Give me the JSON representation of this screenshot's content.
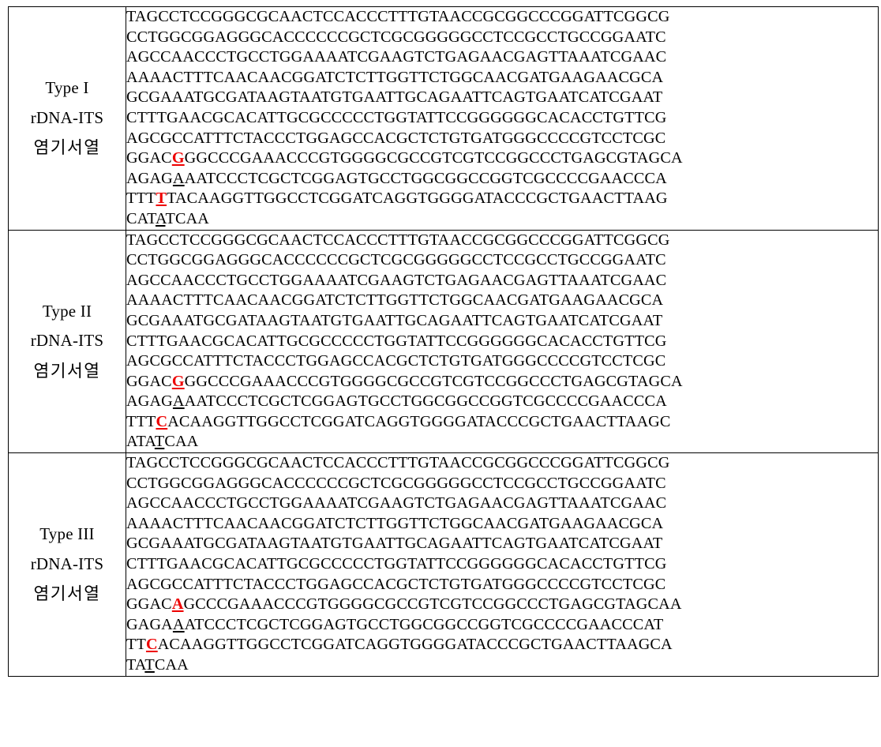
{
  "table": {
    "colors": {
      "mutation": "#ee0000",
      "text": "#000000",
      "border": "#000000",
      "background": "#ffffff"
    },
    "rows": [
      {
        "label": {
          "type_line": "Type I",
          "gene_line": "rDNA-ITS",
          "korean_line": "염기서열"
        },
        "sequence_lines": [
          [
            {
              "t": "TAGCCTCCGGGCGCAACTCCACCCTTTGTAACCGCGGCCCGGATTCGGCG",
              "s": "plain"
            }
          ],
          [
            {
              "t": "CCTGGCGGAGGGCACCCCCCGCTCGCGGGGGCCTCCGCCTGCCGGAATC",
              "s": "plain"
            }
          ],
          [
            {
              "t": "AGCCAACCCTGCCTGGAAAATCGAAGTCTGAGAACGAGTTAAATCGAAC",
              "s": "plain"
            }
          ],
          [
            {
              "t": "AAAACTTTCAACAACGGATCTCTTGGTTCTGGCAACGATGAAGAACGCA",
              "s": "plain"
            }
          ],
          [
            {
              "t": "GCGAAATGCGATAAGTAATGTGAATTGCAGAATTCAGTGAATCATCGAAT",
              "s": "plain"
            }
          ],
          [
            {
              "t": "CTTTGAACGCACATTGCGCCCCCTGGTATTCCGGGGGGCACACCTGTTCG",
              "s": "plain"
            }
          ],
          [
            {
              "t": "AGCGCCATTTCTACCCTGGAGCCACGCTCTGTGATGGGCCCCGTCCTCGC",
              "s": "plain"
            }
          ],
          [
            {
              "t": "GGAC",
              "s": "plain"
            },
            {
              "t": "G",
              "s": "mut"
            },
            {
              "t": "GGCCCGAAACCCGTGGGGCGCCGTCGTCCGGCCCTGAGCGTAGCA",
              "s": "plain"
            }
          ],
          [
            {
              "t": "AGAG",
              "s": "plain"
            },
            {
              "t": "A",
              "s": "ul"
            },
            {
              "t": "AATCCCTCGCTCGGAGTGCCTGGCGGCCGGTCGCCCCGAACCCA",
              "s": "plain"
            }
          ],
          [
            {
              "t": "TTT",
              "s": "plain"
            },
            {
              "t": "T",
              "s": "mut"
            },
            {
              "t": "TACAAGGTTGGCCTCGGATCAGGTGGGGATACCCGCTGAACTTAAG",
              "s": "plain"
            }
          ],
          [
            {
              "t": "CAT",
              "s": "plain"
            },
            {
              "t": "A",
              "s": "ul"
            },
            {
              "t": "TCAA",
              "s": "plain"
            }
          ]
        ]
      },
      {
        "label": {
          "type_line": "Type II",
          "gene_line": "rDNA-ITS",
          "korean_line": "염기서열"
        },
        "sequence_lines": [
          [
            {
              "t": "TAGCCTCCGGGCGCAACTCCACCCTTTGTAACCGCGGCCCGGATTCGGCG",
              "s": "plain"
            }
          ],
          [
            {
              "t": "CCTGGCGGAGGGCACCCCCCGCTCGCGGGGGCCTCCGCCTGCCGGAATC",
              "s": "plain"
            }
          ],
          [
            {
              "t": "AGCCAACCCTGCCTGGAAAATCGAAGTCTGAGAACGAGTTAAATCGAAC",
              "s": "plain"
            }
          ],
          [
            {
              "t": "AAAACTTTCAACAACGGATCTCTTGGTTCTGGCAACGATGAAGAACGCA",
              "s": "plain"
            }
          ],
          [
            {
              "t": "GCGAAATGCGATAAGTAATGTGAATTGCAGAATTCAGTGAATCATCGAAT",
              "s": "plain"
            }
          ],
          [
            {
              "t": "CTTTGAACGCACATTGCGCCCCCTGGTATTCCGGGGGGCACACCTGTTCG",
              "s": "plain"
            }
          ],
          [
            {
              "t": "AGCGCCATTTCTACCCTGGAGCCACGCTCTGTGATGGGCCCCGTCCTCGC",
              "s": "plain"
            }
          ],
          [
            {
              "t": "GGAC",
              "s": "plain"
            },
            {
              "t": "G",
              "s": "mut"
            },
            {
              "t": "GGCCCGAAACCCGTGGGGCGCCGTCGTCCGGCCCTGAGCGTAGCA",
              "s": "plain"
            }
          ],
          [
            {
              "t": "AGAG",
              "s": "plain"
            },
            {
              "t": "A",
              "s": "ul"
            },
            {
              "t": "AATCCCTCGCTCGGAGTGCCTGGCGGCCGGTCGCCCCGAACCCA",
              "s": "plain"
            }
          ],
          [
            {
              "t": "TTT",
              "s": "plain"
            },
            {
              "t": "C",
              "s": "mut"
            },
            {
              "t": "ACAAGGTTGGCCTCGGATCAGGTGGGGATACCCGCTGAACTTAAGC",
              "s": "plain"
            }
          ],
          [
            {
              "t": "ATA",
              "s": "plain"
            },
            {
              "t": "T",
              "s": "ul"
            },
            {
              "t": "CAA",
              "s": "plain"
            }
          ]
        ]
      },
      {
        "label": {
          "type_line": "Type III",
          "gene_line": "rDNA-ITS",
          "korean_line": "염기서열"
        },
        "sequence_lines": [
          [
            {
              "t": "TAGCCTCCGGGCGCAACTCCACCCTTTGTAACCGCGGCCCGGATTCGGCG",
              "s": "plain"
            }
          ],
          [
            {
              "t": "CCTGGCGGAGGGCACCCCCCGCTCGCGGGGGCCTCCGCCTGCCGGAATC",
              "s": "plain"
            }
          ],
          [
            {
              "t": "AGCCAACCCTGCCTGGAAAATCGAAGTCTGAGAACGAGTTAAATCGAAC",
              "s": "plain"
            }
          ],
          [
            {
              "t": "AAAACTTTCAACAACGGATCTCTTGGTTCTGGCAACGATGAAGAACGCA",
              "s": "plain"
            }
          ],
          [
            {
              "t": "GCGAAATGCGATAAGTAATGTGAATTGCAGAATTCAGTGAATCATCGAAT",
              "s": "plain"
            }
          ],
          [
            {
              "t": "CTTTGAACGCACATTGCGCCCCCTGGTATTCCGGGGGGCACACCTGTTCG",
              "s": "plain"
            }
          ],
          [
            {
              "t": "AGCGCCATTTCTACCCTGGAGCCACGCTCTGTGATGGGCCCCGTCCTCGC",
              "s": "plain"
            }
          ],
          [
            {
              "t": "GGAC",
              "s": "plain"
            },
            {
              "t": "A",
              "s": "mut"
            },
            {
              "t": "GCCCGAAACCCGTGGGGCGCCGTCGTCCGGCCCTGAGCGTAGCAA",
              "s": "plain"
            }
          ],
          [
            {
              "t": "GAGA",
              "s": "plain"
            },
            {
              "t": "A",
              "s": "ul"
            },
            {
              "t": "ATCCCTCGCTCGGAGTGCCTGGCGGCCGGTCGCCCCGAACCCAT",
              "s": "plain"
            }
          ],
          [
            {
              "t": "TT",
              "s": "plain"
            },
            {
              "t": "C",
              "s": "mut"
            },
            {
              "t": "ACAAGGTTGGCCTCGGATCAGGTGGGGATACCCGCTGAACTTAAGCA",
              "s": "plain"
            }
          ],
          [
            {
              "t": "TA",
              "s": "plain"
            },
            {
              "t": "T",
              "s": "ul"
            },
            {
              "t": "CAA",
              "s": "plain"
            }
          ]
        ]
      }
    ]
  }
}
